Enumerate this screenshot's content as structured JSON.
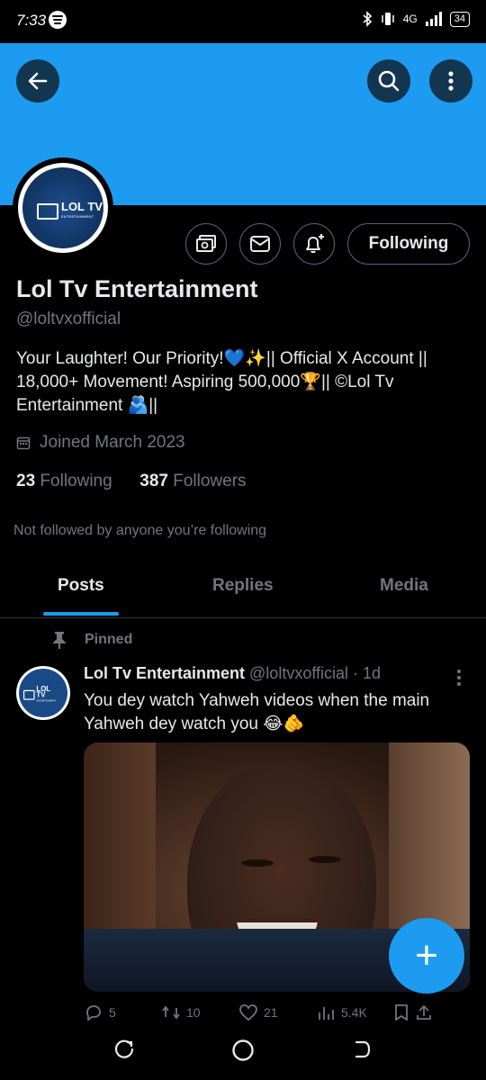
{
  "status_bar": {
    "time": "7:33",
    "network": "4G",
    "battery": "34"
  },
  "icons": {
    "back": "arrow-left-icon",
    "search": "search-icon",
    "more": "more-vertical-icon",
    "media_button": "media-icon",
    "message": "mail-icon",
    "notify": "bell-plus-icon",
    "calendar": "calendar-icon",
    "pin": "pin-icon",
    "compose": "plus-icon"
  },
  "colors": {
    "accent": "#1d9bf0",
    "background": "#000000",
    "text": "#e7e9ea",
    "muted": "#71767b"
  },
  "profile": {
    "name": "Lol Tv Entertainment",
    "handle": "@loltvxofficial",
    "bio": "Your Laughter! Our Priority!💙✨|| Official X Account || 18,000+ Movement! Aspiring 500,000🏆|| ©Lol Tv Entertainment 🫂||",
    "joined": "Joined March 2023",
    "following_count": "23",
    "following_label": "Following",
    "followers_count": "387",
    "followers_label": "Followers",
    "not_followed": "Not followed by anyone you’re following",
    "logo_text": "LOL TV",
    "logo_sub": "ENTERTAINMENT"
  },
  "follow_button": {
    "label": "Following"
  },
  "tabs": [
    {
      "label": "Posts",
      "active": true
    },
    {
      "label": "Replies",
      "active": false
    },
    {
      "label": "Media",
      "active": false
    }
  ],
  "post": {
    "pinned_label": "Pinned",
    "author_name": "Lol Tv Entertainment",
    "author_handle": "@loltvxofficial",
    "separator": "·",
    "time": "1d",
    "text": "You dey watch Yahweh videos when the main Yahweh dey watch you 😂🫵",
    "actions": [
      {
        "icon": "reply-icon",
        "value": "5"
      },
      {
        "icon": "repost-icon",
        "value": "10"
      },
      {
        "icon": "like-icon",
        "value": "21"
      },
      {
        "icon": "views-icon",
        "value": "5.4K"
      },
      {
        "icon": "bookmark-icon",
        "value": ""
      }
    ]
  }
}
